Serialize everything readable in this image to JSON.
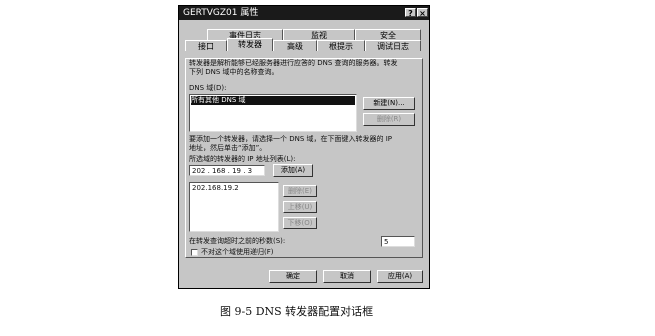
{
  "window": {
    "title": "GERTVGZ01 属性",
    "help_button": "?",
    "close_button": "×"
  },
  "tabs_row1": [
    "事件日志",
    "监视",
    "安全"
  ],
  "tabs_row2": [
    "接口",
    "转发器",
    "高级",
    "根提示",
    "调试日志"
  ],
  "forwarders": {
    "description_line1": "转发器是解析能够已经服务器进行应答的 DNS 查询的服务器。转发",
    "description_line2": "下列 DNS 域中的名称查询。",
    "dns_domain_label": "DNS 域(D):",
    "dns_domain_selected": "所有其他 DNS 域",
    "new_button": "新建(N)...",
    "remove_button": "删除(R)",
    "hint_line1": "要添加一个转发器，请选择一个 DNS 域，在下面键入转发器的 IP",
    "hint_line2": "地址，然后单击“添加”。",
    "ip_list_label": "所选域的转发器的 IP 地址列表(L):",
    "ip_input_value": "202 . 168 . 19 . 3",
    "add_button": "添加(A)",
    "ip_list": [
      "202.168.19.2"
    ],
    "delete_button": "删除(E)",
    "up_button": "上移(U)",
    "down_button": "下移(O)",
    "timeout_label": "在转发查询超时之前的秒数(S):",
    "timeout_value": "5",
    "no_recursion_label": "不对这个域使用递归(F)"
  },
  "footer": {
    "ok": "确定",
    "cancel": "取消",
    "apply": "应用(A)"
  },
  "caption": "图 9-5   DNS 转发器配置对话框"
}
